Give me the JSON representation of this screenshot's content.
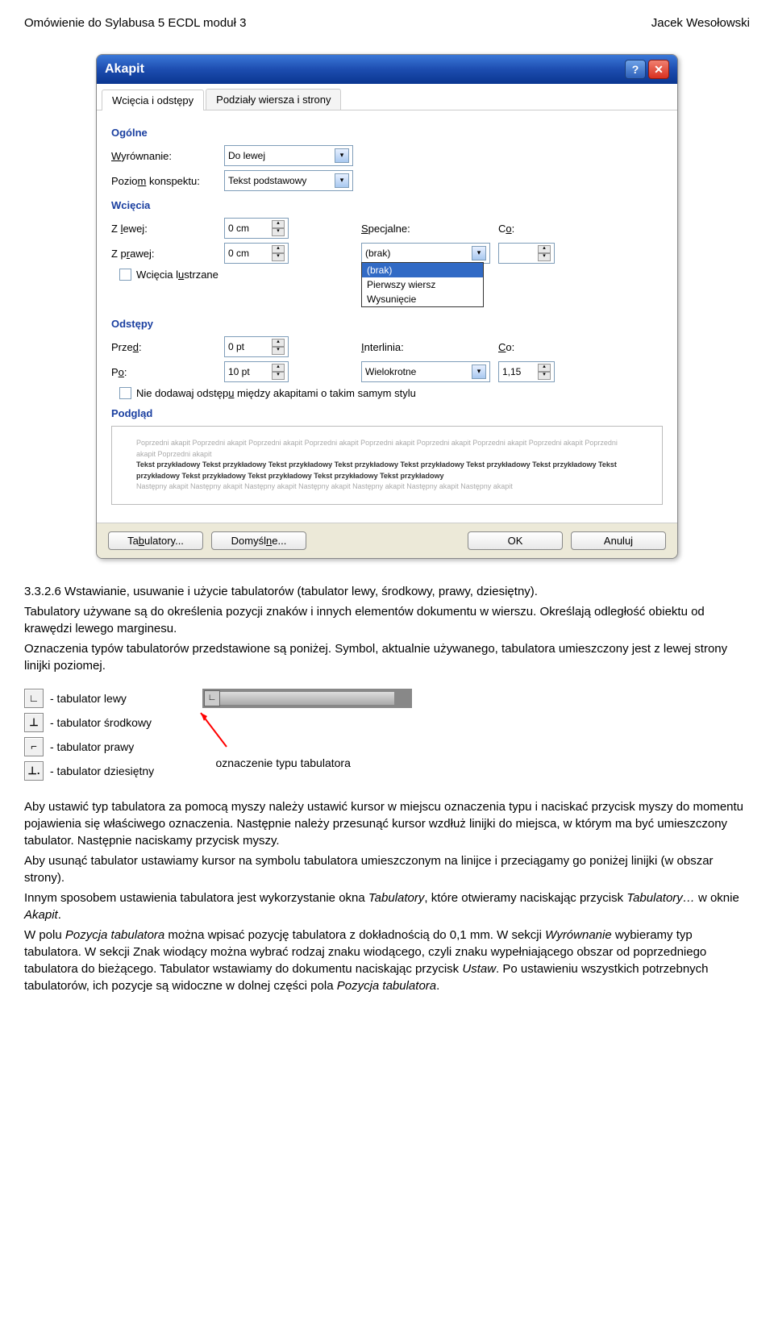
{
  "header": {
    "left": "Omówienie do Sylabusa 5 ECDL moduł 3",
    "right": "Jacek Wesołowski"
  },
  "dialog": {
    "title": "Akapit",
    "tabs": [
      "Wcięcia i odstępy",
      "Podziały wiersza i strony"
    ],
    "sections": {
      "general": "Ogólne",
      "indent": "Wcięcia",
      "spacing": "Odstępy",
      "preview": "Podgląd"
    },
    "labels": {
      "alignment": "Wyrównanie:",
      "outline": "Poziom konspektu:",
      "left": "Z lewej:",
      "right": "Z prawej:",
      "special": "Specjalne:",
      "by": "Co:",
      "before": "Przed:",
      "after": "Po:",
      "linespacing": "Interlinia:",
      "at": "Co:",
      "mirror": "Wcięcia lustrzane",
      "nospace": "Nie dodawaj odstępu między akapitami o takim samym stylu"
    },
    "values": {
      "alignment": "Do lewej",
      "outline": "Tekst podstawowy",
      "left": "0 cm",
      "right": "0 cm",
      "special": "(brak)",
      "special_options": [
        "(brak)",
        "Pierwszy wiersz",
        "Wysunięcie"
      ],
      "before": "0 pt",
      "after": "10 pt",
      "linespacing": "Wielokrotne",
      "at": "1,15"
    },
    "preview": {
      "grey1": "Poprzedni akapit Poprzedni akapit Poprzedni akapit Poprzedni akapit Poprzedni akapit Poprzedni akapit Poprzedni akapit Poprzedni akapit Poprzedni akapit Poprzedni akapit",
      "dark": "Tekst przykładowy Tekst przykładowy Tekst przykładowy Tekst przykładowy Tekst przykładowy Tekst przykładowy Tekst przykładowy Tekst przykładowy Tekst przykładowy Tekst przykładowy Tekst przykładowy Tekst przykładowy",
      "grey2": "Następny akapit Następny akapit Następny akapit Następny akapit Następny akapit Następny akapit Następny akapit"
    },
    "buttons": {
      "tabs": "Tabulatory...",
      "default": "Domyślne...",
      "ok": "OK",
      "cancel": "Anuluj"
    }
  },
  "body": {
    "section_heading": "3.3.2.6 Wstawianie, usuwanie i użycie tabulatorów (tabulator lewy, środkowy, prawy, dziesiętny).",
    "para1": "Tabulatory używane są do określenia pozycji znaków i innych elementów dokumentu w wierszu. Określają odległość obiektu od krawędzi lewego marginesu.",
    "para2": "Oznaczenia typów tabulatorów przedstawione są poniżej. Symbol, aktualnie używanego, tabulatora umieszczony jest z lewej strony linijki poziomej.",
    "tabstops": {
      "left": "- tabulator lewy",
      "center": "- tabulator środkowy",
      "right": "- tabulator prawy",
      "decimal": "- tabulator dziesiętny"
    },
    "ruler_caption": "oznaczenie typu tabulatora",
    "para3a": "Aby ustawić typ tabulatora za pomocą myszy należy ustawić kursor w miejscu oznaczenia typu i naciskać przycisk myszy do momentu pojawienia się właściwego oznaczenia. Następnie należy przesunąć kursor wzdłuż linijki do miejsca, w którym ma być umieszczony tabulator. Następnie naciskamy przycisk myszy.",
    "para3b": "Aby usunąć tabulator ustawiamy kursor na symbolu tabulatora umieszczonym na linijce i przeciągamy go poniżej linijki (w obszar strony).",
    "para3c_1": "Innym sposobem ustawienia tabulatora jest wykorzystanie okna ",
    "para3c_i1": "Tabulatory",
    "para3c_2": ", które otwieramy naciskając przycisk ",
    "para3c_i2": "Tabulatory…",
    "para3c_3": " w oknie ",
    "para3c_i3": "Akapit",
    "para3c_4": ".",
    "para3d_1": "W polu ",
    "para3d_i1": "Pozycja tabulatora",
    "para3d_2": " można wpisać pozycję tabulatora z dokładnością do 0,1 mm. W sekcji ",
    "para3d_i2": "Wyrównanie",
    "para3d_3": " wybieramy typ tabulatora. W sekcji Znak wiodący można wybrać rodzaj znaku wiodącego, czyli znaku wypełniającego obszar od poprzedniego tabulatora do bieżącego. Tabulator wstawiamy do dokumentu naciskając przycisk ",
    "para3d_i3": "Ustaw",
    "para3d_4": ". Po ustawieniu wszystkich potrzebnych tabulatorów, ich pozycje są widoczne w dolnej części pola ",
    "para3d_i4": "Pozycja tabulatora",
    "para3d_5": "."
  }
}
